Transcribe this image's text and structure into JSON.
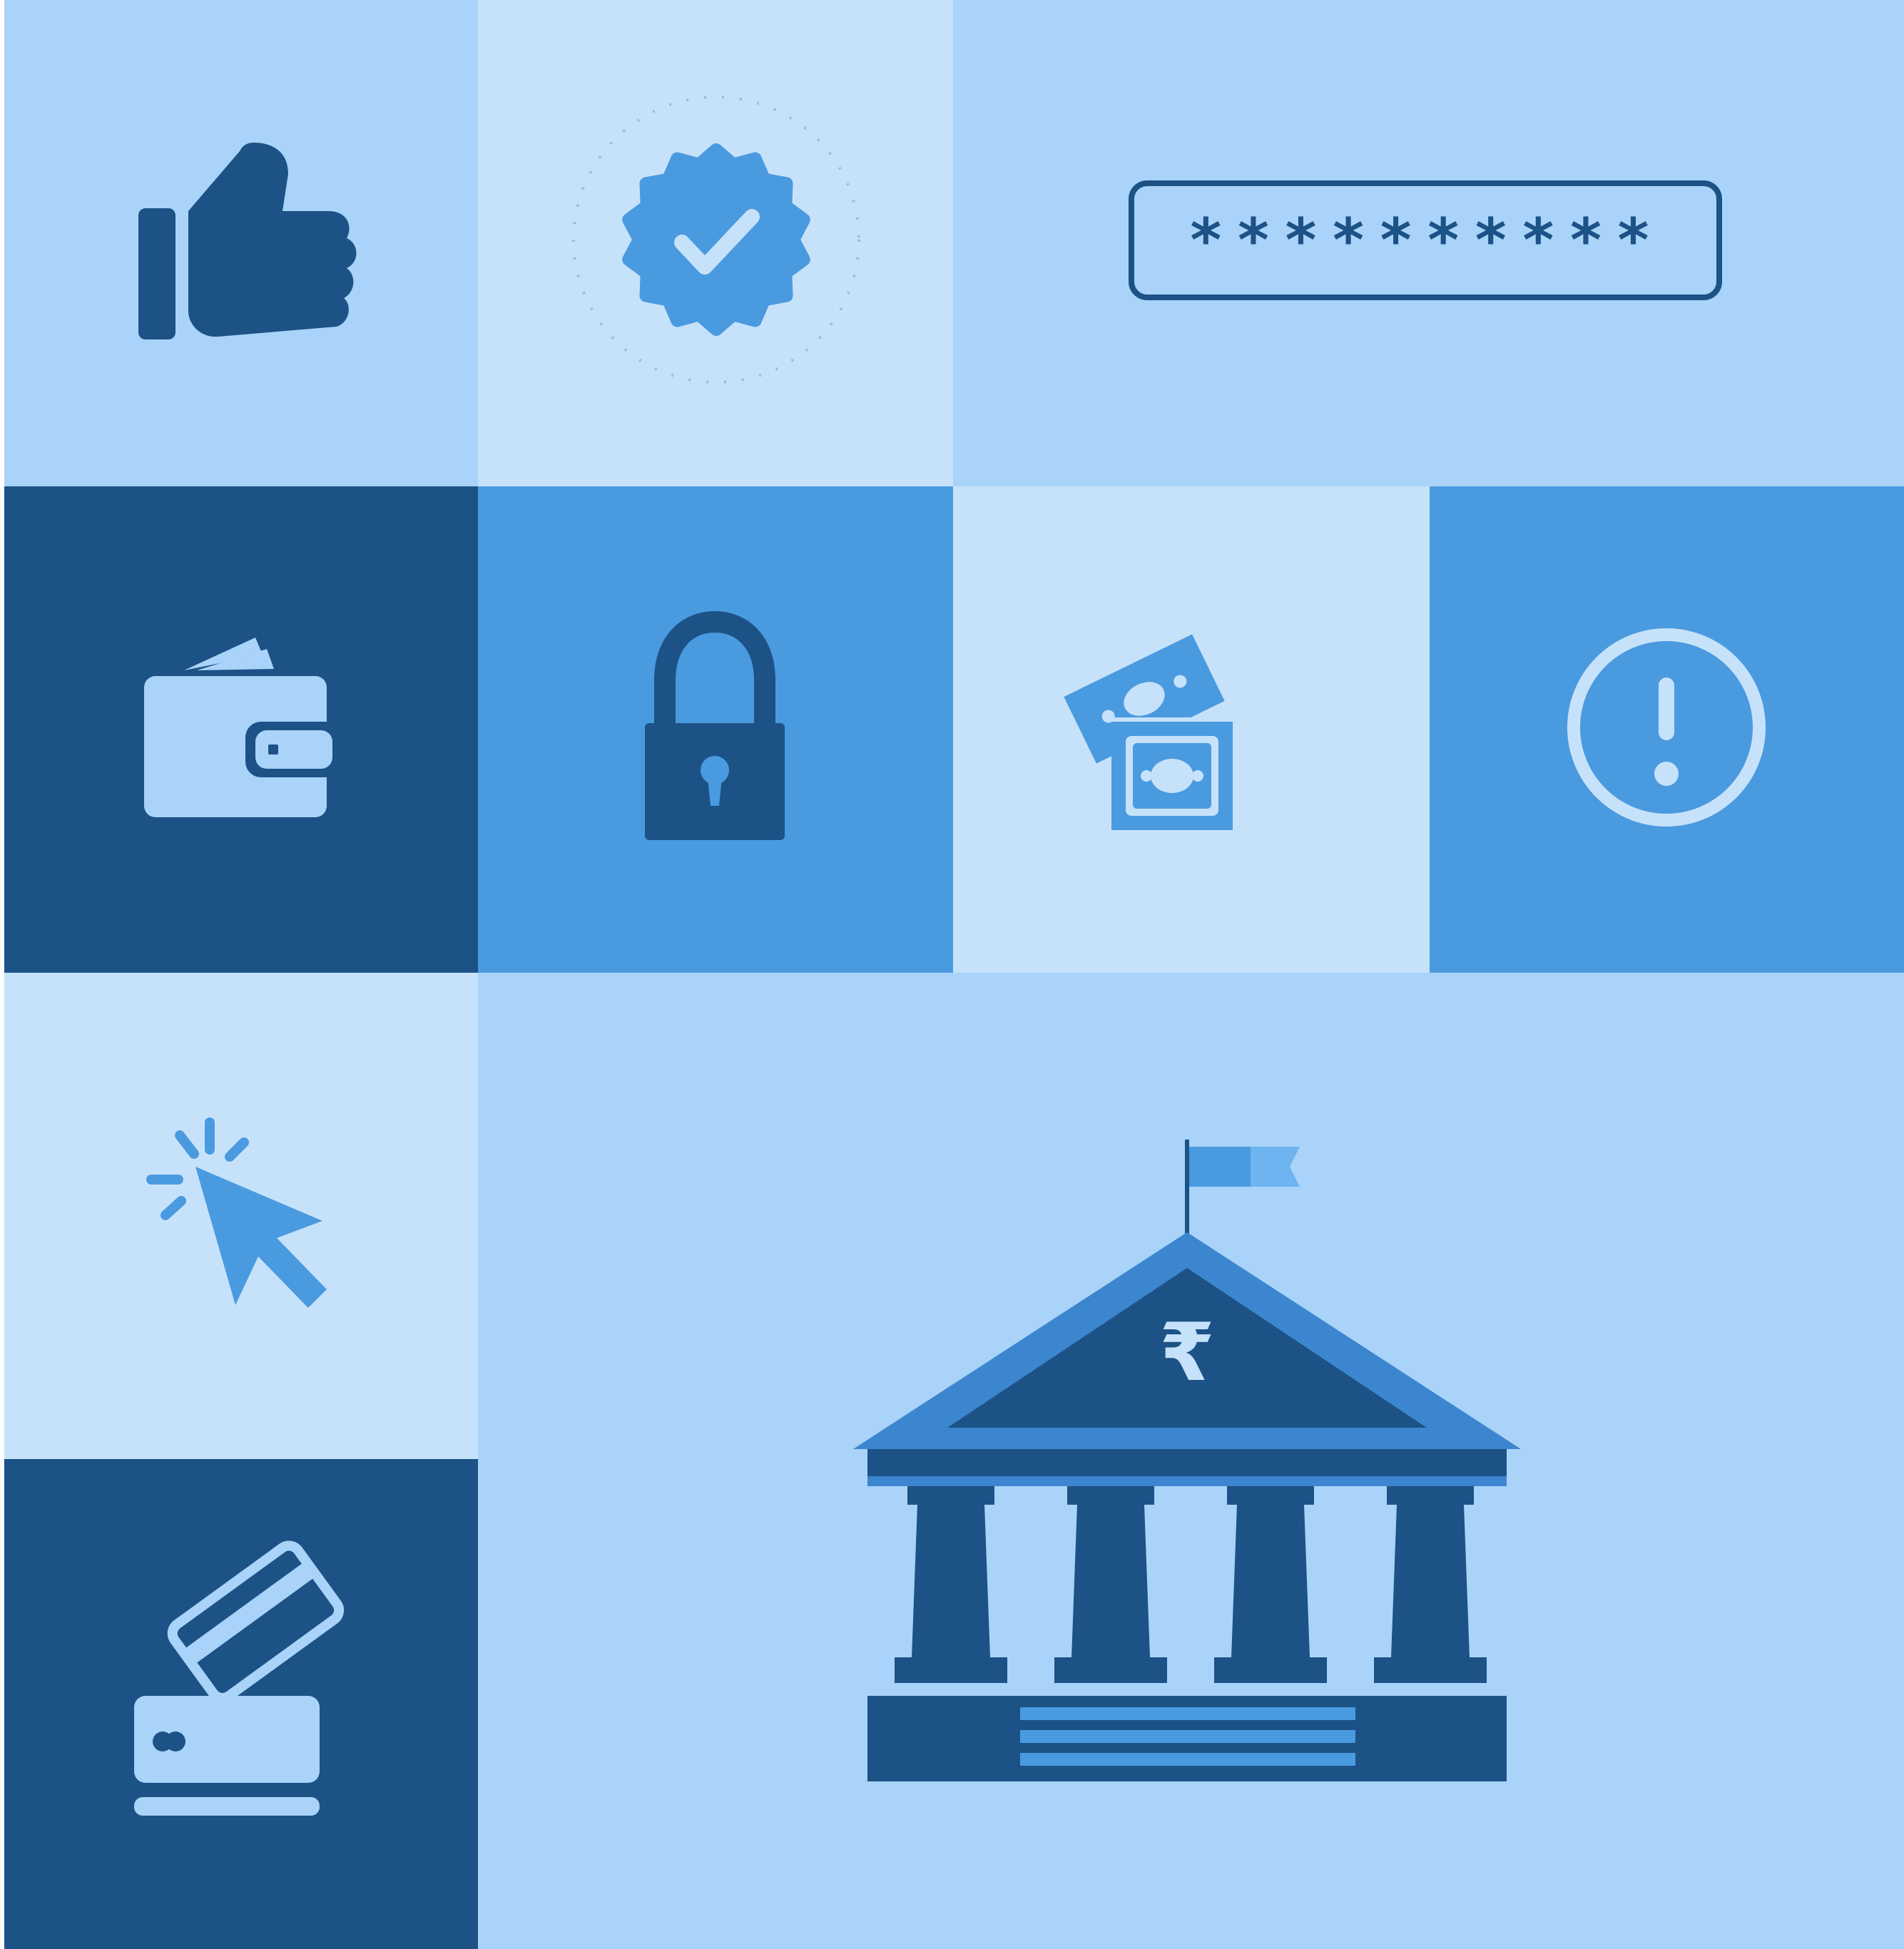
{
  "palette": {
    "light": "#a9d3f8",
    "pale": "#c6e2fa",
    "medium": "#4a9ae0",
    "navy": "#1c5286",
    "mid_blue": "#3c86cf"
  },
  "password_field": {
    "masked_value": "**********"
  },
  "bank": {
    "currency_symbol": "₹"
  }
}
